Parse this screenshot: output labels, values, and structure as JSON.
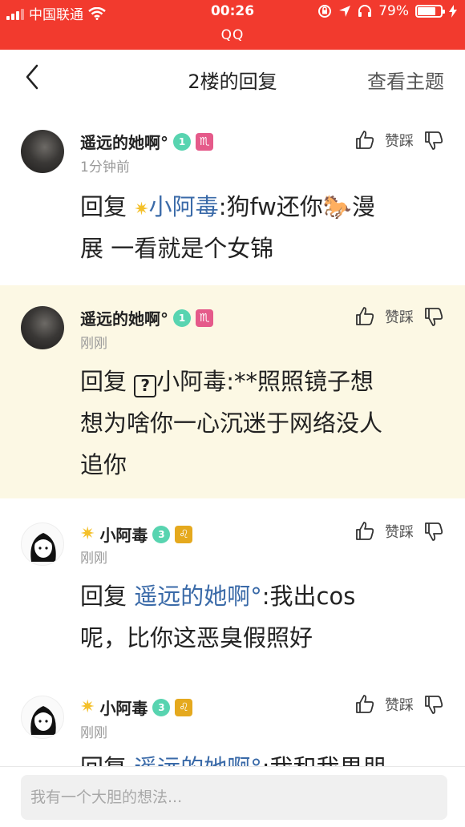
{
  "status_bar": {
    "carrier": "中国联通",
    "time": "00:26",
    "battery": "79%",
    "battery_level": 0.79,
    "app": "QQ"
  },
  "nav": {
    "title": "2楼的回复",
    "action": "查看主题"
  },
  "comments": [
    {
      "name": "遥远的她啊°",
      "gem_level": "1",
      "zodiac": "♏",
      "time": "1分钟前",
      "like_label": "赞",
      "dislike_label": "踩",
      "reply_prefix": "回复",
      "mention": "小阿毒",
      "text_line1": ":狗fw还你🐎漫",
      "text_line2": "展 一看就是个女锦"
    },
    {
      "name": "遥远的她啊°",
      "gem_level": "1",
      "zodiac": "♏",
      "time": "刚刚",
      "like_label": "赞",
      "dislike_label": "踩",
      "reply_prefix": "回复",
      "unknown_glyph": "?",
      "mention": "小阿毒",
      "text_line1": ":**照照镜子想",
      "text_line2": "想为啥你一心沉迷于网络没人",
      "text_line3": "追你"
    },
    {
      "name": "小阿毒",
      "gem_level": "3",
      "zodiac": "♌",
      "time": "刚刚",
      "like_label": "赞",
      "dislike_label": "踩",
      "reply_prefix": "回复",
      "mention": "遥远的她啊°",
      "text_line1": ":我出cos",
      "text_line2": "呢，比你这恶臭假照好"
    },
    {
      "name": "小阿毒",
      "gem_level": "3",
      "zodiac": "♌",
      "time": "刚刚",
      "like_label": "赞",
      "dislike_label": "踩",
      "reply_prefix": "回复",
      "mention": "遥远的她啊°",
      "text_line1": ":我和我男朋"
    }
  ],
  "input": {
    "placeholder": "我有一个大胆的想法..."
  },
  "colors": {
    "status_bar_bg": "#f23a2e",
    "highlight_bg": "#fcf8e4",
    "mention": "#3a6aa8",
    "gem": "#58d4b0",
    "scorpio_badge": "#e55a8a",
    "leo_badge": "#e5a91e"
  },
  "icons": [
    "signal-icon",
    "wifi-icon",
    "lock-rotation-icon",
    "location-icon",
    "headphones-icon",
    "battery-icon",
    "charging-icon",
    "back-chevron-icon",
    "thumbs-up-icon",
    "thumbs-down-icon",
    "gem-icon",
    "star-icon",
    "horse-emoji"
  ]
}
